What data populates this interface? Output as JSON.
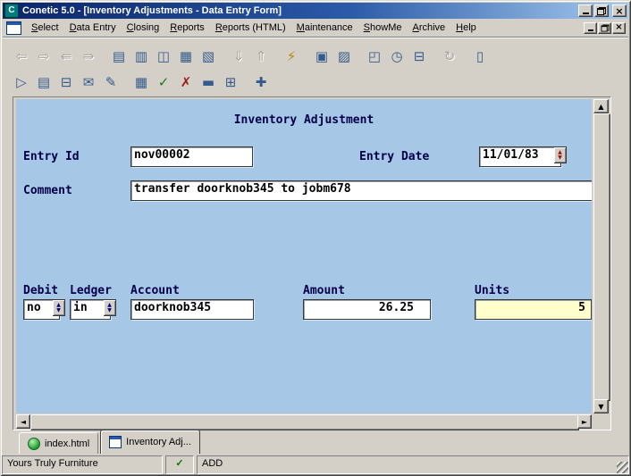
{
  "window": {
    "title": "Conetic 5.0 - [Inventory Adjustments  - Data Entry Form]"
  },
  "icons": {
    "app_letter": "C",
    "close": "×",
    "scroll_up": "▲",
    "scroll_down": "▼",
    "scroll_left": "◄",
    "scroll_right": "►",
    "spin_up": "▲",
    "spin_down": "▼"
  },
  "menu": {
    "items": [
      "Select",
      "Data Entry",
      "Closing",
      "Reports",
      "Reports (HTML)",
      "Maintenance",
      "ShowMe",
      "Archive",
      "Help"
    ]
  },
  "toolbar": {
    "row1": [
      {
        "name": "record-first-icon",
        "glyph": "⇦",
        "disabled": true
      },
      {
        "name": "record-last-icon",
        "glyph": "⇨",
        "disabled": true
      },
      {
        "name": "record-prev-icon",
        "glyph": "⇚",
        "disabled": true
      },
      {
        "name": "record-next-icon",
        "glyph": "⇛",
        "disabled": true
      },
      {
        "sep": true
      },
      {
        "name": "form-clear-icon",
        "glyph": "▤",
        "color": "#355b8c"
      },
      {
        "name": "form-recall-icon",
        "glyph": "▥",
        "color": "#355b8c"
      },
      {
        "name": "form-duplicate-icon",
        "glyph": "◫",
        "color": "#355b8c"
      },
      {
        "name": "form-window-icon",
        "glyph": "▦",
        "color": "#355b8c"
      },
      {
        "name": "form-transfer-icon",
        "glyph": "▧",
        "color": "#355b8c"
      },
      {
        "sep": true
      },
      {
        "name": "page-down-icon",
        "glyph": "⇓",
        "disabled": true
      },
      {
        "name": "page-up-icon",
        "glyph": "⇑",
        "disabled": true
      },
      {
        "sep": true
      },
      {
        "name": "execute-query-icon",
        "glyph": "⚡",
        "color": "#b8860b"
      },
      {
        "sep": true
      },
      {
        "name": "copy-icon",
        "glyph": "▣",
        "color": "#355b8c"
      },
      {
        "name": "paste-icon",
        "glyph": "▨",
        "color": "#355b8c"
      },
      {
        "sep": true
      },
      {
        "name": "window-list-icon",
        "glyph": "◰",
        "color": "#355b8c"
      },
      {
        "name": "clock-icon",
        "glyph": "◷",
        "color": "#355b8c"
      },
      {
        "name": "print-icon",
        "glyph": "⊟",
        "color": "#355b8c"
      },
      {
        "sep": true
      },
      {
        "name": "refresh-icon",
        "glyph": "↻",
        "disabled": true
      },
      {
        "sep": true
      },
      {
        "name": "exit-icon",
        "glyph": "▯",
        "color": "#355b8c"
      }
    ],
    "row2": [
      {
        "name": "report-run-icon",
        "glyph": "▷",
        "color": "#355b8c"
      },
      {
        "name": "report-preview-icon",
        "glyph": "▤",
        "color": "#355b8c"
      },
      {
        "name": "report-print-icon",
        "glyph": "⊟",
        "color": "#355b8c"
      },
      {
        "name": "report-mail-icon",
        "glyph": "✉",
        "color": "#355b8c"
      },
      {
        "name": "report-edit-icon",
        "glyph": "✎",
        "color": "#355b8c"
      },
      {
        "sep": true
      },
      {
        "name": "grid-view-icon",
        "glyph": "▦",
        "color": "#355b8c"
      },
      {
        "name": "grid-accept-icon",
        "glyph": "✓",
        "color": "#1c7a1c"
      },
      {
        "name": "grid-cancel-icon",
        "glyph": "✗",
        "color": "#9c1c1c"
      },
      {
        "name": "delete-record-icon",
        "glyph": "▬",
        "color": "#355b8c"
      },
      {
        "name": "calculator-icon",
        "glyph": "⊞",
        "color": "#355b8c"
      },
      {
        "sep": true
      },
      {
        "name": "new-window-icon",
        "glyph": "✚",
        "color": "#355b8c"
      }
    ]
  },
  "form": {
    "title": "Inventory Adjustment",
    "entry_id": {
      "label": "Entry Id",
      "value": "nov00002"
    },
    "entry_date": {
      "label": "Entry Date",
      "value": "11/01/83"
    },
    "comment": {
      "label": "Comment",
      "value": "transfer doorknob345 to jobm678"
    },
    "debit": {
      "label": "Debit",
      "value": "no"
    },
    "ledger": {
      "label": "Ledger",
      "value": "in"
    },
    "account": {
      "label": "Account",
      "value": "doorknob345"
    },
    "amount": {
      "label": "Amount",
      "value": "26.25"
    },
    "units": {
      "label": "Units",
      "value": "5"
    }
  },
  "tabs": [
    {
      "label": "index.html",
      "icon": "browser",
      "active": false
    },
    {
      "label": "Inventory Adj...",
      "icon": "form",
      "active": true
    }
  ],
  "status": {
    "company": "Yours Truly Furniture",
    "indicator": "✓",
    "mode": "ADD"
  },
  "colors": {
    "form_bg": "#a7c7e7",
    "units_bg": "#ffffcc",
    "chrome": "#d4d0c8",
    "label_navy": "#00004a",
    "titlebar_start": "#0a246a",
    "titlebar_end": "#a6caf0"
  }
}
